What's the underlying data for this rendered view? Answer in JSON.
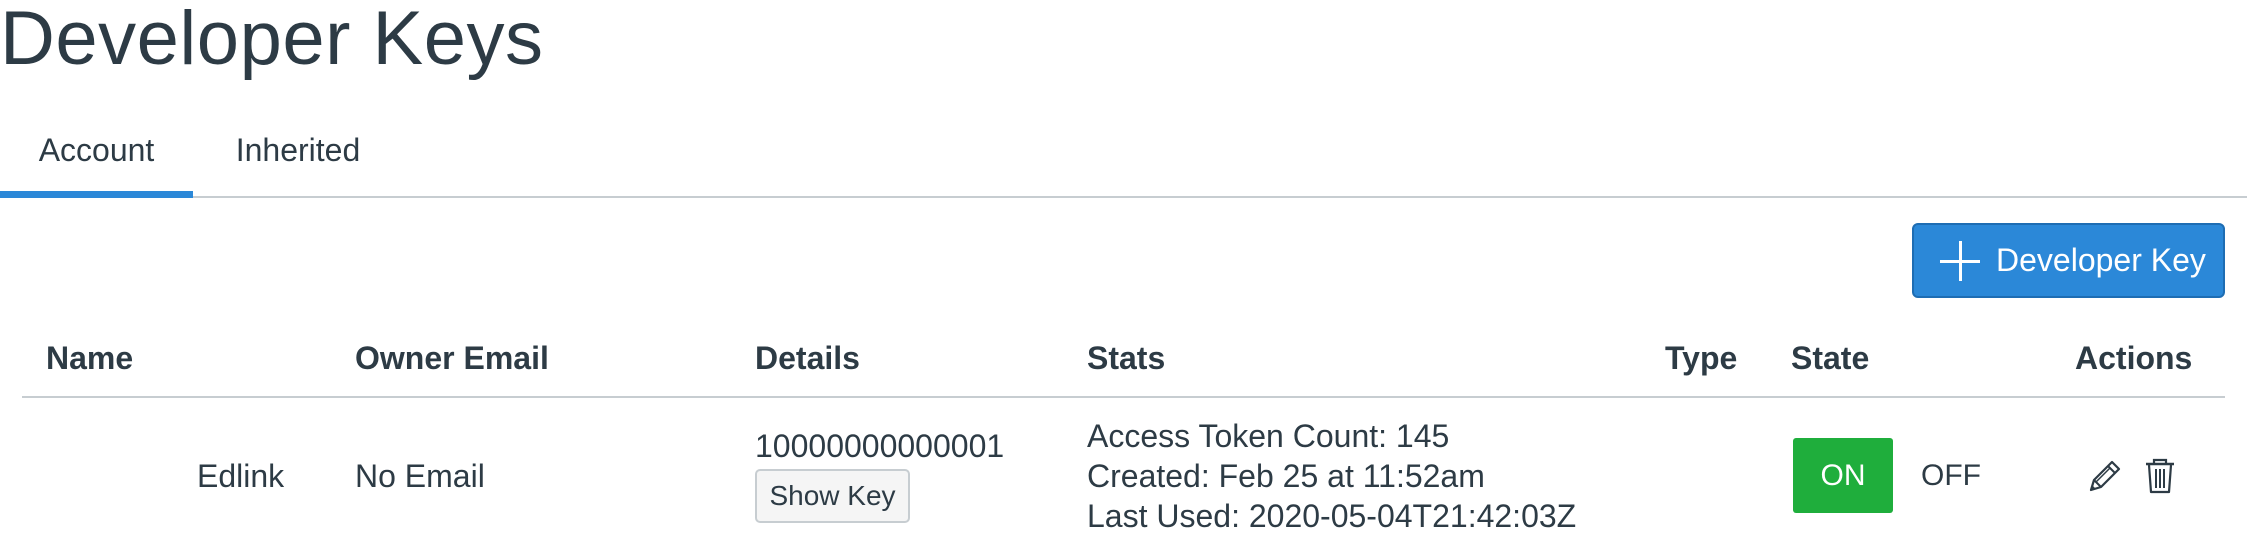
{
  "page": {
    "title": "Developer Keys"
  },
  "tabs": [
    {
      "label": "Account",
      "active": true
    },
    {
      "label": "Inherited",
      "active": false
    }
  ],
  "toolbar": {
    "add_button_label": "Developer Key",
    "add_button_icon": "plus-icon"
  },
  "table": {
    "headers": {
      "name": "Name",
      "owner_email": "Owner Email",
      "details": "Details",
      "stats": "Stats",
      "type": "Type",
      "state": "State",
      "actions": "Actions"
    },
    "rows": [
      {
        "name": "Edlink",
        "owner_email": "No Email",
        "key_id": "10000000000001",
        "show_key_label": "Show Key",
        "stats": {
          "access_token_count": "Access Token Count: 145",
          "created": "Created: Feb 25 at 11:52am",
          "last_used": "Last Used: 2020-05-04T21:42:03Z"
        },
        "type": "",
        "state": {
          "on_label": "ON",
          "off_label": "OFF",
          "selected": "ON"
        },
        "actions": {
          "edit_icon": "pencil-icon",
          "delete_icon": "trash-icon"
        }
      }
    ]
  },
  "colors": {
    "accent": "#2b88d8",
    "on_green": "#1fae3c",
    "text": "#2d3b45",
    "divider": "#c7cdd1"
  }
}
